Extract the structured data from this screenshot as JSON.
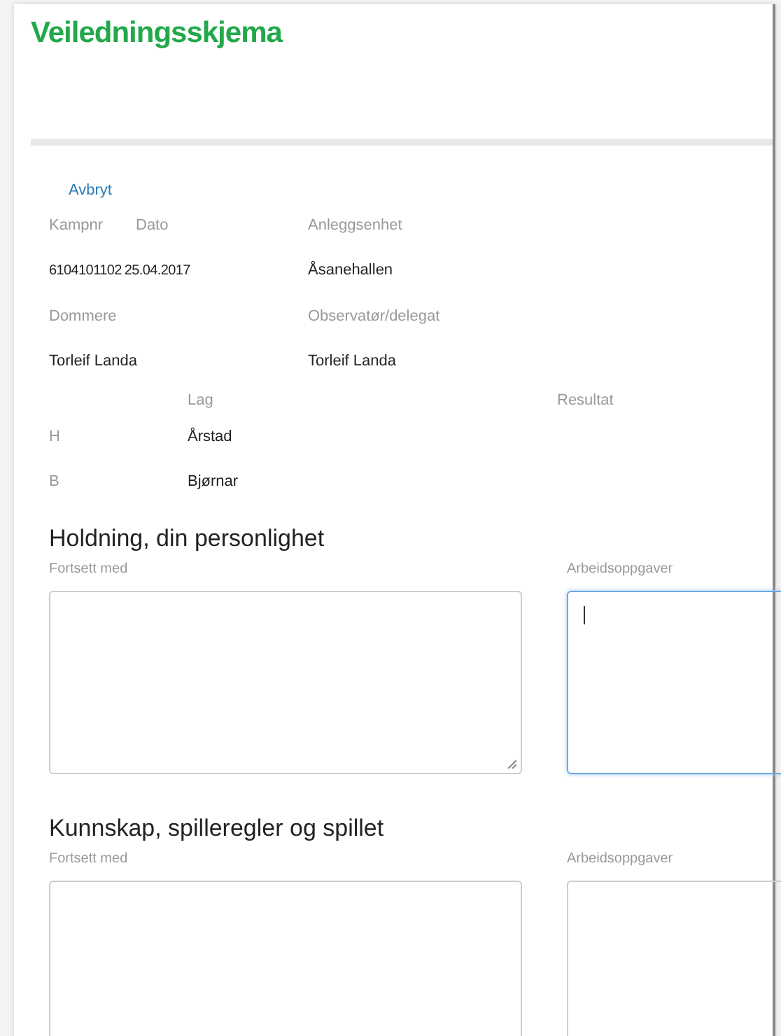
{
  "title": "Veiledningsskjema",
  "cancel_link": "Avbryt",
  "match_info": {
    "kampnr_label": "Kampnr",
    "dato_label": "Dato",
    "anleggsenhet_label": "Anleggsenhet",
    "kampnr": "6104101102",
    "dato": "25.04.2017",
    "anleggsenhet": "Åsanehallen",
    "dommere_label": "Dommere",
    "observator_label": "Observatør/delegat",
    "dommere": "Torleif Landa",
    "observator": "Torleif Landa"
  },
  "teams": {
    "lag_label": "Lag",
    "resultat_label": "Resultat",
    "rows": [
      {
        "side": "H",
        "name": "Årstad"
      },
      {
        "side": "B",
        "name": "Bjørnar"
      }
    ]
  },
  "sections": [
    {
      "heading": "Holdning, din personlighet",
      "fields": [
        {
          "label": "Fortsett med",
          "focused": false
        },
        {
          "label": "Arbeidsoppgaver",
          "focused": true
        }
      ]
    },
    {
      "heading": "Kunnskap, spilleregler og spillet",
      "fields": [
        {
          "label": "Fortsett med",
          "focused": false
        },
        {
          "label": "Arbeidsoppgaver",
          "focused": false
        }
      ]
    }
  ]
}
